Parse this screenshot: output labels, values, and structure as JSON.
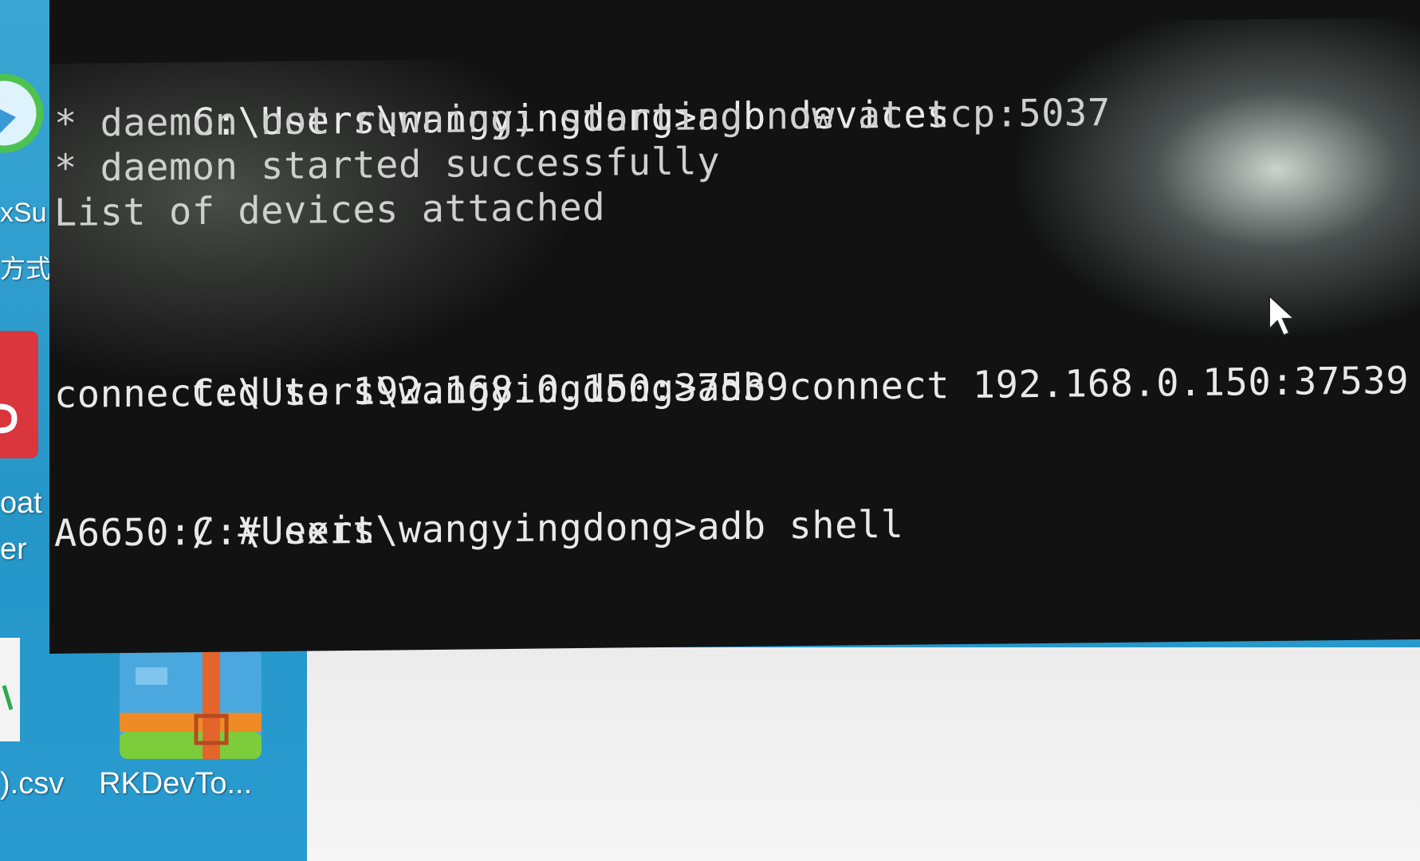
{
  "terminal": {
    "lines": [
      "* daemon not running; starting now at tcp:5037",
      "* daemon started successfully",
      "List of devices attached",
      "connected to 192.168.0.150:37539",
      "A6650:/ # exit"
    ],
    "prompts": [
      {
        "path": "C:\\Users\\wangyingdong>",
        "command": "adb devices"
      },
      {
        "path": "C:\\Users\\wangyingdong>",
        "command": "adb connect 192.168.0.150:37539"
      },
      {
        "path": "C:\\Users\\wangyingdong>",
        "command": "adb shell"
      },
      {
        "path": "C:\\Users\\wangyingdong>",
        "command": ""
      }
    ]
  },
  "desktop": {
    "icon_labels": {
      "partial_1": "xSu",
      "partial_2": "方式",
      "partial_3": "oat",
      "partial_4": "er",
      "csv_file": ").csv",
      "rkdevtool": "RKDevTo..."
    }
  },
  "colors": {
    "terminal_bg": "#121212",
    "terminal_text": "#e9e9e9",
    "desktop_bg": "#2596c8"
  }
}
